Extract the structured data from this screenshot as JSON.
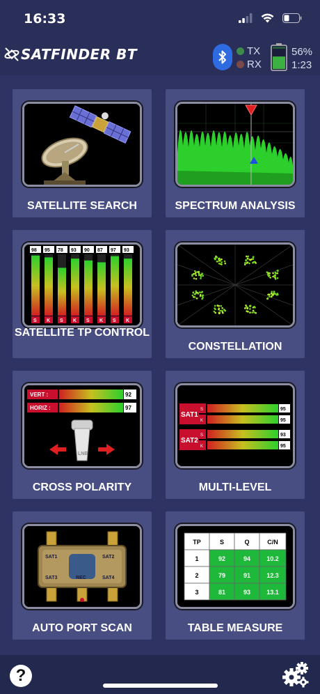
{
  "status": {
    "time": "16:33"
  },
  "header": {
    "app_name": "SATFINDER BT",
    "tx_label": "TX",
    "rx_label": "RX",
    "battery_percent": "56%",
    "battery_time": "1:23",
    "battery_level": 0.56,
    "colors": {
      "bt": "#2e6be0",
      "tx_dot": "#3d8a4a",
      "rx_dot": "#7a4a4a"
    }
  },
  "tiles": [
    {
      "id": "satellite-search",
      "label": "SATELLITE SEARCH"
    },
    {
      "id": "spectrum-analysis",
      "label": "SPECTRUM ANALYSIS"
    },
    {
      "id": "satellite-tp-control",
      "label": "SATELLITE TP CONTROL"
    },
    {
      "id": "constellation",
      "label": "CONSTELLATION"
    },
    {
      "id": "cross-polarity",
      "label": "CROSS POLARITY"
    },
    {
      "id": "multi-level",
      "label": "MULTI-LEVEL"
    },
    {
      "id": "auto-port-scan",
      "label": "AUTO PORT SCAN"
    },
    {
      "id": "table-measure",
      "label": "TABLE MEASURE"
    }
  ],
  "tp_control": {
    "values": [
      "98",
      "95",
      "78",
      "93",
      "90",
      "87",
      "97",
      "93"
    ],
    "bands": [
      "S",
      "K",
      "S",
      "K",
      "S",
      "K",
      "S",
      "K"
    ]
  },
  "cross_polarity": {
    "vert_label": "VERT :",
    "vert_value": "92",
    "horiz_label": "HORIZ :",
    "horiz_value": "97",
    "lnb_label": "LNB"
  },
  "multi_level": {
    "sat1_label": "SAT1",
    "sat2_label": "SAT2",
    "band_s": "S",
    "band_k": "K",
    "sat1_s": "95",
    "sat1_k": "95",
    "sat2_s": "93",
    "sat2_k": "95"
  },
  "port_scan": {
    "ports": [
      "SAT1",
      "SAT2",
      "SAT3",
      "SAT4"
    ],
    "center": "REC"
  },
  "table_measure": {
    "headers": [
      "TP",
      "S",
      "Q",
      "C/N"
    ],
    "rows": [
      [
        "1",
        "92",
        "94",
        "10.2"
      ],
      [
        "2",
        "79",
        "91",
        "12.3"
      ],
      [
        "3",
        "81",
        "93",
        "13.1"
      ]
    ]
  },
  "bottom": {
    "help_symbol": "?"
  }
}
